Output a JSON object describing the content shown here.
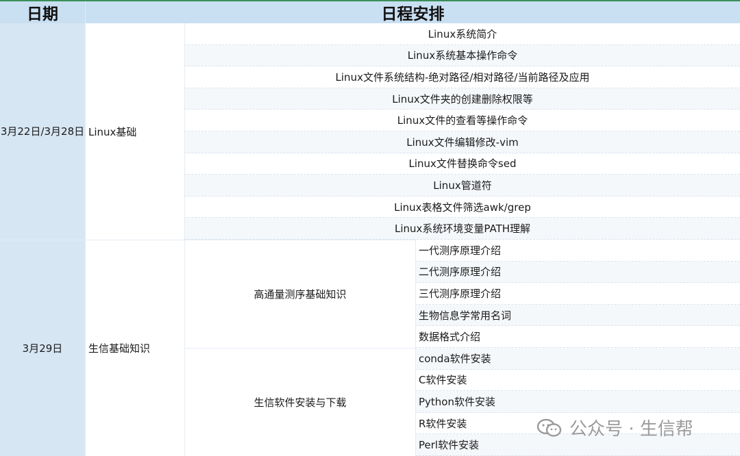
{
  "header": {
    "date_label": "日期",
    "schedule_label": "日程安排"
  },
  "sections": [
    {
      "date": "3月22日/3月28日",
      "topic": "Linux基础",
      "items": [
        "Linux系统简介",
        "Linux系统基本操作命令",
        "Linux文件系统结构-绝对路径/相对路径/当前路径及应用",
        "Linux文件夹的创建删除权限等",
        "Linux文件的查看等操作命令",
        "Linux文件编辑修改-vim",
        "Linux文件替换命令sed",
        "Linux管道符",
        "Linux表格文件筛选awk/grep",
        "Linux系统环境变量PATH理解"
      ]
    },
    {
      "date": "3月29日",
      "topic": "生信基础知识",
      "subgroups": [
        {
          "title": "高通量测序基础知识",
          "items": [
            "一代测序原理介绍",
            "二代测序原理介绍",
            "三代测序原理介绍",
            "生物信息学常用名词",
            "数据格式介绍"
          ]
        },
        {
          "title": "生信软件安装与下载",
          "items": [
            "conda软件安装",
            "C软件安装",
            "Python软件安装",
            "R软件安装",
            "Perl软件安装"
          ]
        }
      ]
    }
  ],
  "watermark": {
    "text": "公众号 · 生信帮",
    "icon": "wechat-icon"
  }
}
